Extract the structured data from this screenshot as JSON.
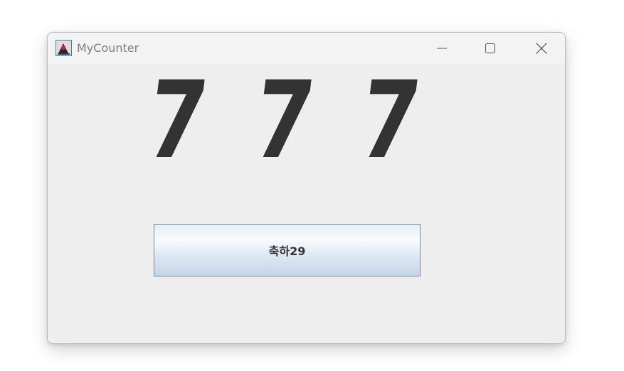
{
  "window": {
    "title": "MyCounter",
    "icon": "java-duke-icon",
    "controls": {
      "minimize": "minimize-icon",
      "maximize": "maximize-icon",
      "close": "close-icon"
    }
  },
  "counter": {
    "digits": [
      "7",
      "7",
      "7"
    ],
    "digit_color": "#333333"
  },
  "action_button": {
    "label": "축하29"
  }
}
